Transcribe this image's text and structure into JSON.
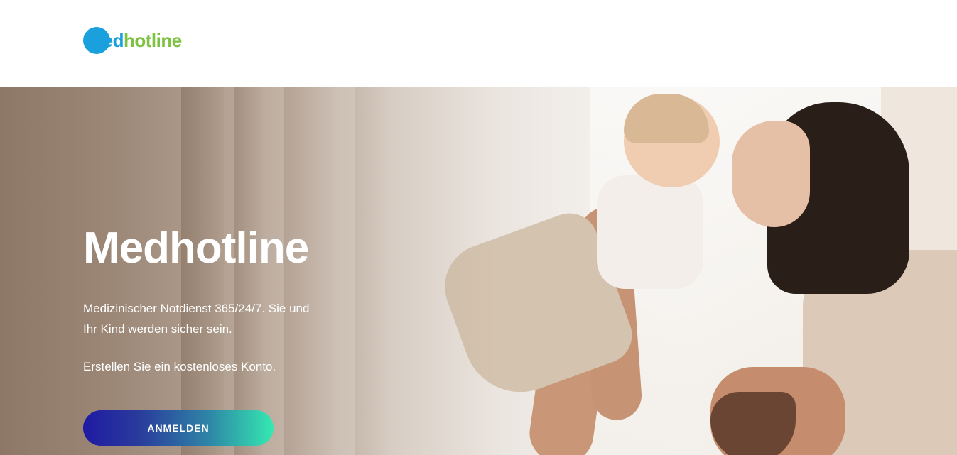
{
  "header": {
    "logo": {
      "part1": "med",
      "part2": "hotline"
    }
  },
  "hero": {
    "title": "Medhotline",
    "description": "Medizinischer Notdienst 365/24/7. Sie und Ihr Kind werden sicher sein.",
    "cta_text": "Erstellen Sie ein kostenloses Konto.",
    "button_label": "ANMELDEN"
  },
  "colors": {
    "brand_blue": "#1aa0dc",
    "brand_green": "#7dc242",
    "button_gradient_start": "#1f1aa3",
    "button_gradient_end": "#35e8b2"
  }
}
